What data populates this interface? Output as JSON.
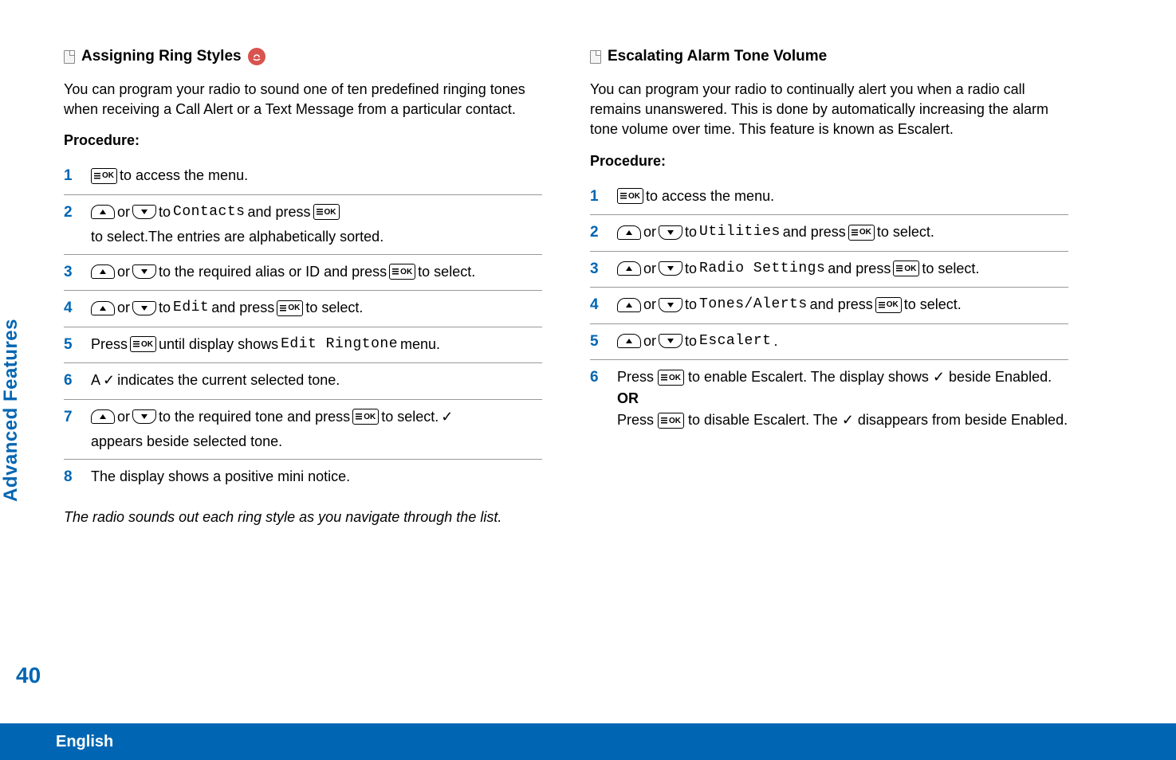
{
  "sidebar": {
    "label": "Advanced Features"
  },
  "page_number": "40",
  "footer": {
    "language": "English"
  },
  "left": {
    "heading": "Assigning Ring Styles",
    "intro": "You can program your radio to sound one of ten predefined ringing tones when receiving a Call Alert or a Text Message from a particular contact.",
    "procedure_label": "Procedure:",
    "steps": {
      "s1": {
        "num": "1",
        "t1": " to access the menu."
      },
      "s2": {
        "num": "2",
        "or": " or ",
        "to": " to ",
        "menu": "Contacts",
        "press": " and press ",
        "rest": " to select.The entries are alphabetically sorted."
      },
      "s3": {
        "num": "3",
        "or": " or ",
        "to": " to the required alias or ID and press ",
        "rest": " to select."
      },
      "s4": {
        "num": "4",
        "or": " or ",
        "to": " to ",
        "menu": "Edit",
        "press": " and press ",
        "rest": " to select."
      },
      "s5": {
        "num": "5",
        "press": "Press ",
        "until": " until display shows ",
        "menu": "Edit Ringtone",
        "rest": " menu."
      },
      "s6": {
        "num": "6",
        "a": "A ",
        "rest": " indicates the current selected tone."
      },
      "s7": {
        "num": "7",
        "or": " or ",
        "to": " to the required tone and press ",
        "sel": " to select. ",
        "rest": " appears beside selected tone."
      },
      "s8": {
        "num": "8",
        "text": "The display shows a positive mini notice."
      }
    },
    "footnote": "The radio sounds out each ring style as you navigate through the list."
  },
  "right": {
    "heading": "Escalating Alarm Tone Volume",
    "intro": "You can program your radio to continually alert you when a radio call remains unanswered. This is done by automatically increasing the alarm tone volume over time. This feature is known as Escalert.",
    "procedure_label": "Procedure:",
    "steps": {
      "s1": {
        "num": "1",
        "t1": " to access the menu."
      },
      "s2": {
        "num": "2",
        "or": " or ",
        "to": " to ",
        "menu": "Utilities",
        "press": " and press ",
        "rest": " to select."
      },
      "s3": {
        "num": "3",
        "or": " or ",
        "to": " to ",
        "menu": "Radio Settings",
        "press": " and press ",
        "rest": " to select."
      },
      "s4": {
        "num": "4",
        "or": " or ",
        "to": " to ",
        "menu": "Tones/Alerts",
        "press": " and press ",
        "rest": " to select."
      },
      "s5": {
        "num": "5",
        "or": " or ",
        "to": " to ",
        "menu": "Escalert",
        "dot": "."
      },
      "s6": {
        "num": "6",
        "press": "Press ",
        "enable": " to enable Escalert. The display shows ",
        "beside": " beside Enabled.",
        "or_label": "OR",
        "press2": "Press ",
        "disable": " to disable Escalert. The ",
        "rest": " disappears from beside Enabled."
      }
    }
  },
  "glyphs": {
    "ok": "OK",
    "check": "✓"
  }
}
